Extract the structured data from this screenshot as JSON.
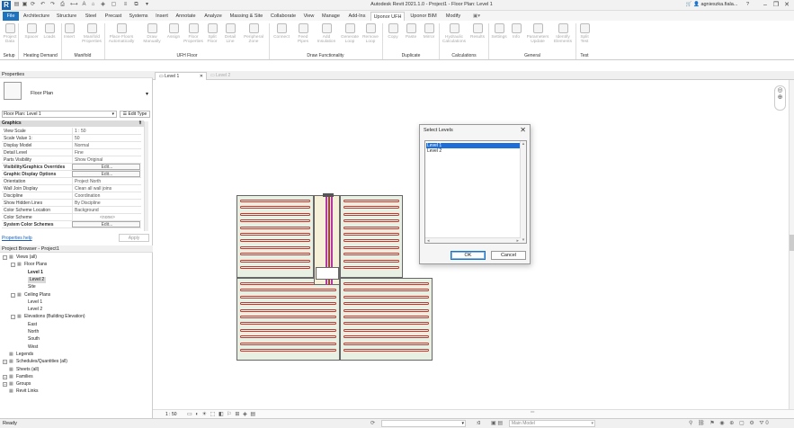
{
  "app": {
    "title": "Autodesk Revit 2021.1.0 - Project1 - Floor Plan: Level 1",
    "user": "agnieszka.fiala...",
    "brand_color": "#1e73be"
  },
  "ribbon_tabs": [
    "File",
    "Architecture",
    "Structure",
    "Steel",
    "Precast",
    "Systems",
    "Insert",
    "Annotate",
    "Analyze",
    "Massing & Site",
    "Collaborate",
    "View",
    "Manage",
    "Add-Ins",
    "Uponor UFH",
    "Uponor BIM",
    "Modify"
  ],
  "active_tab": "Uponor UFH",
  "ribbon": {
    "buttons": [
      {
        "label": "Project Data"
      },
      {
        "label": "Spacer"
      },
      {
        "label": "Loads"
      },
      {
        "label": "Insert"
      },
      {
        "label": "Manifold Properties"
      },
      {
        "label": "Place Floors Automatically"
      },
      {
        "label": "Draw Manually"
      },
      {
        "label": "Assign"
      },
      {
        "label": "Floor Properties"
      },
      {
        "label": "Split Floor"
      },
      {
        "label": "Detail Line"
      },
      {
        "label": "Peripheral Zone"
      },
      {
        "label": "Connect"
      },
      {
        "label": "Feed Pipes"
      },
      {
        "label": "Add Insulation"
      },
      {
        "label": "Generate Loop"
      },
      {
        "label": "Remove Loop"
      },
      {
        "label": "Copy"
      },
      {
        "label": "Paste"
      },
      {
        "label": "Mirror"
      },
      {
        "label": "Hydraulic Calculations"
      },
      {
        "label": "Results"
      },
      {
        "label": "Settings"
      },
      {
        "label": "Info"
      },
      {
        "label": "Parameters Update"
      },
      {
        "label": "Identify Elements"
      },
      {
        "label": "Split Test"
      }
    ],
    "panels": [
      "Setup",
      "Heating Demand",
      "Manifold",
      "UFH Floor",
      "Draw Functionality",
      "Duplicate",
      "Calculations",
      "General",
      "Test"
    ]
  },
  "properties": {
    "header": "Properties",
    "type_name": "Floor Plan",
    "selector": "Floor Plan: Level 1",
    "edit_type": "Edit Type",
    "group": "Graphics",
    "rows": [
      {
        "k": "View Scale",
        "v": "1 : 50"
      },
      {
        "k": "Scale Value    1:",
        "v": "50"
      },
      {
        "k": "Display Model",
        "v": "Normal"
      },
      {
        "k": "Detail Level",
        "v": "Fine"
      },
      {
        "k": "Parts Visibility",
        "v": "Show Original"
      },
      {
        "k": "Visibility/Graphics Overrides",
        "v": "Edit..."
      },
      {
        "k": "Graphic Display Options",
        "v": "Edit..."
      },
      {
        "k": "Orientation",
        "v": "Project North"
      },
      {
        "k": "Wall Join Display",
        "v": "Clean all wall joins"
      },
      {
        "k": "Discipline",
        "v": "Coordination"
      },
      {
        "k": "Show Hidden Lines",
        "v": "By Discipline"
      },
      {
        "k": "Color Scheme Location",
        "v": "Background"
      },
      {
        "k": "Color Scheme",
        "v": "<none>"
      },
      {
        "k": "System Color Schemes",
        "v": "Edit..."
      }
    ],
    "help_link": "Properties help",
    "apply": "Apply"
  },
  "browser": {
    "header": "Project Browser - Project1",
    "nodes": [
      {
        "t": "Views (all)",
        "d": 0,
        "tog": "-"
      },
      {
        "t": "Floor Plans",
        "d": 1,
        "tog": "-"
      },
      {
        "t": "Level 1",
        "d": 2,
        "bold": true
      },
      {
        "t": "Level 2",
        "d": 2,
        "sel": true
      },
      {
        "t": "Site",
        "d": 2
      },
      {
        "t": "Ceiling Plans",
        "d": 1,
        "tog": "-"
      },
      {
        "t": "Level 1",
        "d": 2
      },
      {
        "t": "Level 2",
        "d": 2
      },
      {
        "t": "Elevations (Building Elevation)",
        "d": 1,
        "tog": "-"
      },
      {
        "t": "East",
        "d": 2
      },
      {
        "t": "North",
        "d": 2
      },
      {
        "t": "South",
        "d": 2
      },
      {
        "t": "West",
        "d": 2
      },
      {
        "t": "Legends",
        "d": 0
      },
      {
        "t": "Schedules/Quantities (all)",
        "d": 0,
        "tog": "+"
      },
      {
        "t": "Sheets (all)",
        "d": 0
      },
      {
        "t": "Families",
        "d": 0,
        "tog": "+"
      },
      {
        "t": "Groups",
        "d": 0,
        "tog": "+"
      },
      {
        "t": "Revit Links",
        "d": 0
      }
    ]
  },
  "view_tabs": [
    "Level 1",
    "Level 2"
  ],
  "dialog": {
    "title": "Select Levels",
    "items": [
      "Level 1",
      "Level 2"
    ],
    "selected_index": 0,
    "ok": "OK",
    "cancel": "Cancel"
  },
  "view_bar": {
    "scale": "1 : 50"
  },
  "status": {
    "text": "Ready",
    "model": "Main Model",
    "coord": ":0"
  }
}
